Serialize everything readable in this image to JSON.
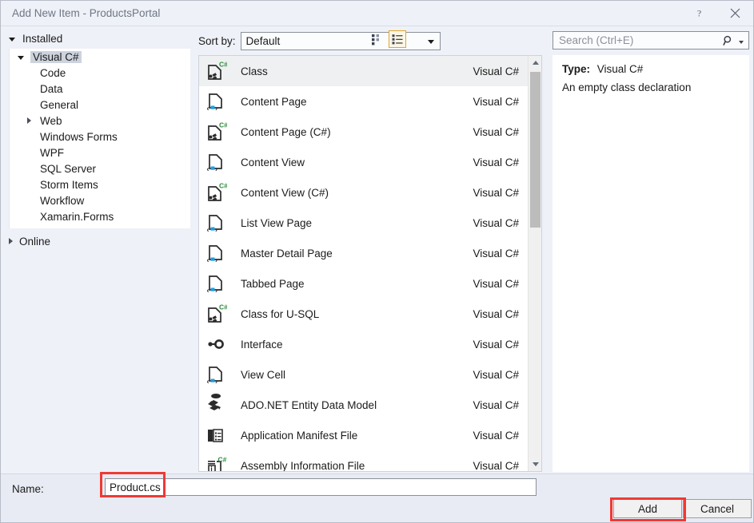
{
  "window": {
    "title": "Add New Item - ProductsPortal",
    "help_button": "?",
    "close_button": "✕"
  },
  "left_panel": {
    "installed_header": "Installed",
    "online_header": "Online",
    "tree": [
      {
        "label": "Visual C#",
        "indent": 0,
        "expander": "down",
        "selected": true
      },
      {
        "label": "Code",
        "indent": 1,
        "expander": "none",
        "selected": false
      },
      {
        "label": "Data",
        "indent": 1,
        "expander": "none",
        "selected": false
      },
      {
        "label": "General",
        "indent": 1,
        "expander": "none",
        "selected": false
      },
      {
        "label": "Web",
        "indent": 1,
        "expander": "right",
        "selected": false
      },
      {
        "label": "Windows Forms",
        "indent": 1,
        "expander": "none",
        "selected": false
      },
      {
        "label": "WPF",
        "indent": 1,
        "expander": "none",
        "selected": false
      },
      {
        "label": "SQL Server",
        "indent": 1,
        "expander": "none",
        "selected": false
      },
      {
        "label": "Storm Items",
        "indent": 1,
        "expander": "none",
        "selected": false
      },
      {
        "label": "Workflow",
        "indent": 1,
        "expander": "none",
        "selected": false
      },
      {
        "label": "Xamarin.Forms",
        "indent": 1,
        "expander": "none",
        "selected": false
      }
    ]
  },
  "toolbar": {
    "sort_by_label": "Sort by:",
    "sort_by_value": "Default",
    "view_tiles_icon": "tiles-view-icon",
    "view_list_icon": "list-view-icon",
    "view_list_selected": true,
    "selected_border_color": "#e0a62d"
  },
  "search": {
    "placeholder": "Search (Ctrl+E)",
    "value": "",
    "icon": "search-icon"
  },
  "templates": [
    {
      "name": "Class",
      "language": "Visual C#",
      "icon": "csharp-class-icon",
      "selected": true
    },
    {
      "name": "Content Page",
      "language": "Visual C#",
      "icon": "xaml-page-icon",
      "selected": false
    },
    {
      "name": "Content Page (C#)",
      "language": "Visual C#",
      "icon": "csharp-class-icon",
      "selected": false
    },
    {
      "name": "Content View",
      "language": "Visual C#",
      "icon": "xaml-page-icon",
      "selected": false
    },
    {
      "name": "Content View (C#)",
      "language": "Visual C#",
      "icon": "csharp-class-icon",
      "selected": false
    },
    {
      "name": "List View Page",
      "language": "Visual C#",
      "icon": "xaml-page-icon",
      "selected": false
    },
    {
      "name": "Master Detail Page",
      "language": "Visual C#",
      "icon": "xaml-page-icon",
      "selected": false
    },
    {
      "name": "Tabbed Page",
      "language": "Visual C#",
      "icon": "xaml-page-icon",
      "selected": false
    },
    {
      "name": "Class for U-SQL",
      "language": "Visual C#",
      "icon": "csharp-class-icon",
      "selected": false
    },
    {
      "name": "Interface",
      "language": "Visual C#",
      "icon": "interface-icon",
      "selected": false
    },
    {
      "name": "View Cell",
      "language": "Visual C#",
      "icon": "xaml-page-icon",
      "selected": false
    },
    {
      "name": "ADO.NET Entity Data Model",
      "language": "Visual C#",
      "icon": "entity-data-model-icon",
      "selected": false
    },
    {
      "name": "Application Manifest File",
      "language": "Visual C#",
      "icon": "manifest-file-icon",
      "selected": false
    },
    {
      "name": "Assembly Information File",
      "language": "Visual C#",
      "icon": "assembly-info-icon",
      "selected": false
    }
  ],
  "details": {
    "type_label": "Type:",
    "type_value": "Visual C#",
    "description": "An empty class declaration"
  },
  "footer": {
    "name_label": "Name:",
    "name_value": "Product.cs",
    "add_label": "Add",
    "cancel_label": "Cancel"
  },
  "annotations": {
    "color": "#ef3a34",
    "highlighted": [
      "name-input",
      "add-button"
    ]
  }
}
